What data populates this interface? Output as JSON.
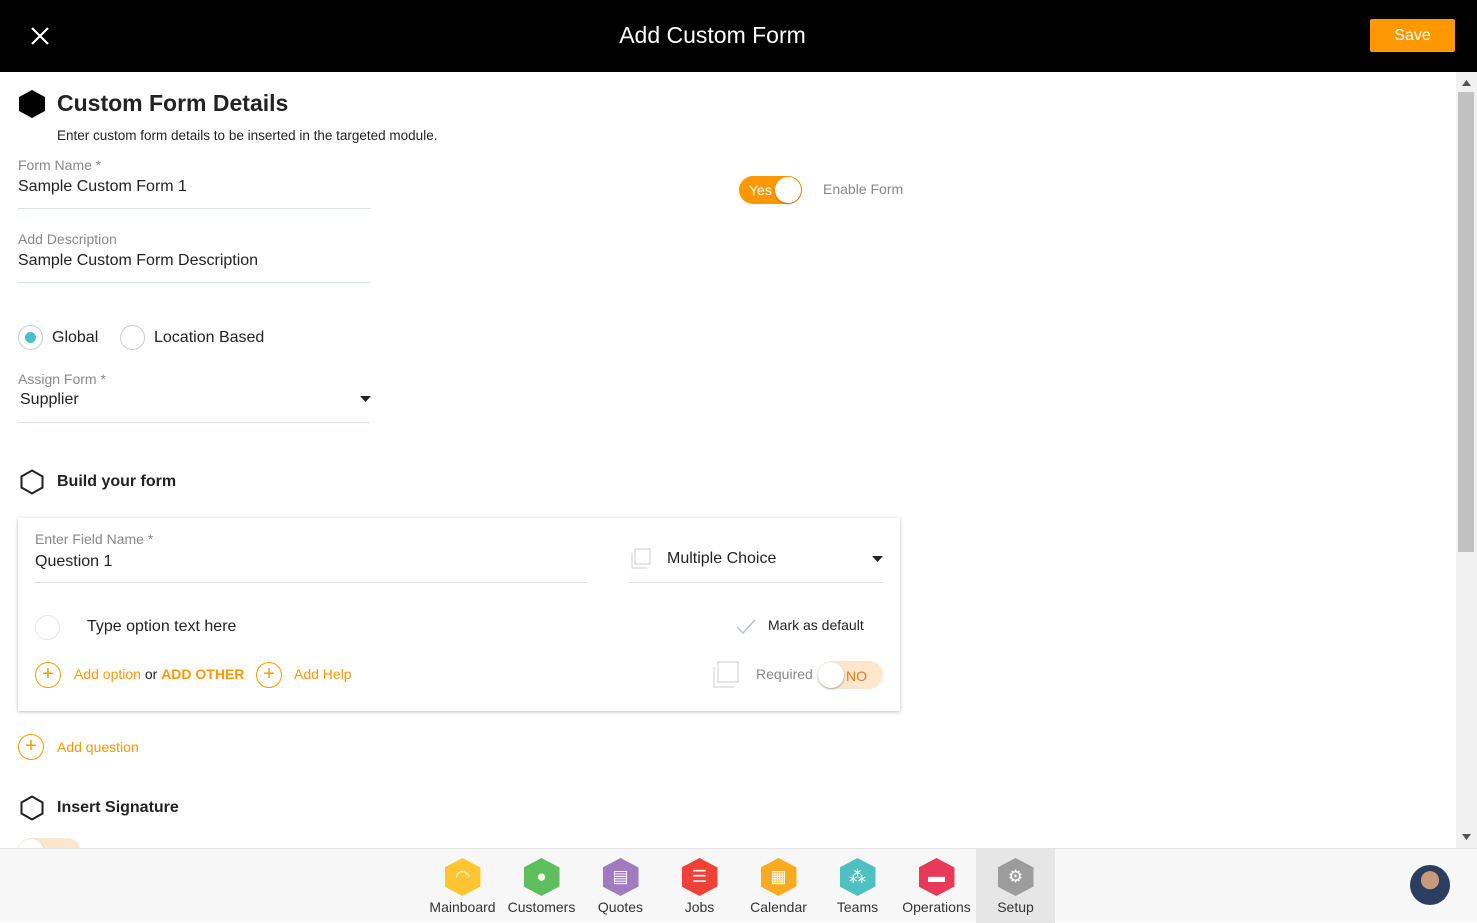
{
  "header": {
    "title": "Add Custom Form",
    "save_label": "Save"
  },
  "details": {
    "heading": "Custom Form Details",
    "subtitle": "Enter custom form details to be inserted in the targeted module.",
    "form_name_label": "Form Name *",
    "form_name_value": "Sample Custom Form 1",
    "description_label": "Add Description",
    "description_value": "Sample Custom Form Description",
    "enable_toggle": "Yes",
    "enable_label": "Enable Form",
    "radio_global": "Global",
    "radio_location": "Location Based",
    "selected_scope": "Global",
    "assign_label": "Assign Form *",
    "assign_value": "Supplier"
  },
  "build": {
    "heading": "Build your form",
    "field_label": "Enter Field Name *",
    "field_value": "Question 1",
    "type_value": "Multiple Choice",
    "option_placeholder": "Type option text here",
    "mark_default": "Mark as default",
    "add_option": "Add option",
    "or": "or",
    "add_other": "ADD OTHER",
    "add_help": "Add Help",
    "required_label": "Required",
    "required_toggle": "NO",
    "add_question": "Add question"
  },
  "signature": {
    "heading": "Insert Signature"
  },
  "colors": {
    "accent": "#ff9800",
    "teal": "#4bc0c8"
  },
  "dock": [
    {
      "label": "Mainboard",
      "color": "#fdc52f",
      "icon": "dashboard-icon"
    },
    {
      "label": "Customers",
      "color": "#5fbf5f",
      "icon": "user-icon"
    },
    {
      "label": "Quotes",
      "color": "#a07bc0",
      "icon": "quotes-icon"
    },
    {
      "label": "Jobs",
      "color": "#ef4136",
      "icon": "list-icon"
    },
    {
      "label": "Calendar",
      "color": "#f8ab21",
      "icon": "calendar-icon"
    },
    {
      "label": "Teams",
      "color": "#4fc0c2",
      "icon": "teams-icon"
    },
    {
      "label": "Operations",
      "color": "#e8395a",
      "icon": "briefcase-icon"
    },
    {
      "label": "Setup",
      "color": "#9c9c9c",
      "icon": "gear-icon"
    }
  ]
}
